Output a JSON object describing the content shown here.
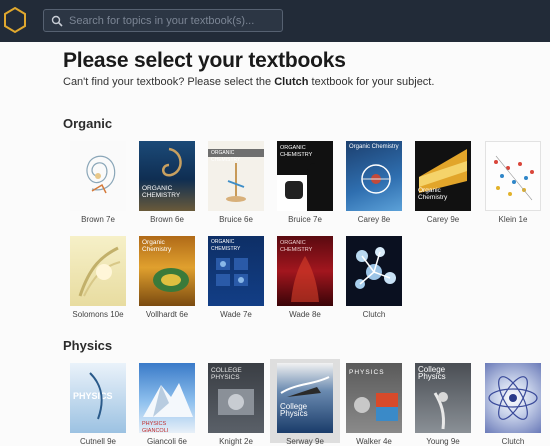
{
  "header": {
    "search_placeholder": "Search for topics in your textbook(s)..."
  },
  "page": {
    "title": "Please select your textbooks",
    "subtitle_before": "Can't find your textbook? Please select the ",
    "subtitle_bold": "Clutch",
    "subtitle_after": " textbook for your subject."
  },
  "sections": {
    "organic": {
      "label": "Organic",
      "books": [
        {
          "label": "Brown 7e",
          "cover_text": ""
        },
        {
          "label": "Brown 6e",
          "cover_text": "ORGANIC CHEMISTRY"
        },
        {
          "label": "Bruice 6e",
          "cover_text": "ORGANIC CHEMISTRY"
        },
        {
          "label": "Bruice 7e",
          "cover_text": "ORGANIC CHEMISTRY"
        },
        {
          "label": "Carey 8e",
          "cover_text": "Organic Chemistry"
        },
        {
          "label": "Carey 9e",
          "cover_text": "Organic Chemistry"
        },
        {
          "label": "Klein 1e",
          "cover_text": ""
        },
        {
          "label": "Solomons 10e",
          "cover_text": ""
        },
        {
          "label": "Vollhardt 6e",
          "cover_text": "Organic Chemistry"
        },
        {
          "label": "Wade 7e",
          "cover_text": "ORGANIC CHEMISTRY"
        },
        {
          "label": "Wade 8e",
          "cover_text": "ORGANIC CHEMISTRY"
        },
        {
          "label": "Clutch",
          "cover_text": ""
        }
      ]
    },
    "physics": {
      "label": "Physics",
      "books": [
        {
          "label": "Cutnell 9e",
          "cover_text": "PHYSICS"
        },
        {
          "label": "Giancoli 6e",
          "cover_text": "PHYSICS GIANCOLI"
        },
        {
          "label": "Knight 2e",
          "cover_text": "COLLEGE PHYSICS"
        },
        {
          "label": "Serway 9e",
          "cover_text": "College Physics"
        },
        {
          "label": "Walker 4e",
          "cover_text": "PHYSICS"
        },
        {
          "label": "Young 9e",
          "cover_text": "College Physics"
        },
        {
          "label": "Clutch",
          "cover_text": ""
        }
      ]
    }
  },
  "colors": {
    "topbar": "#222b38",
    "logo": "#e0a82e",
    "selected_bg": "#dedede"
  }
}
